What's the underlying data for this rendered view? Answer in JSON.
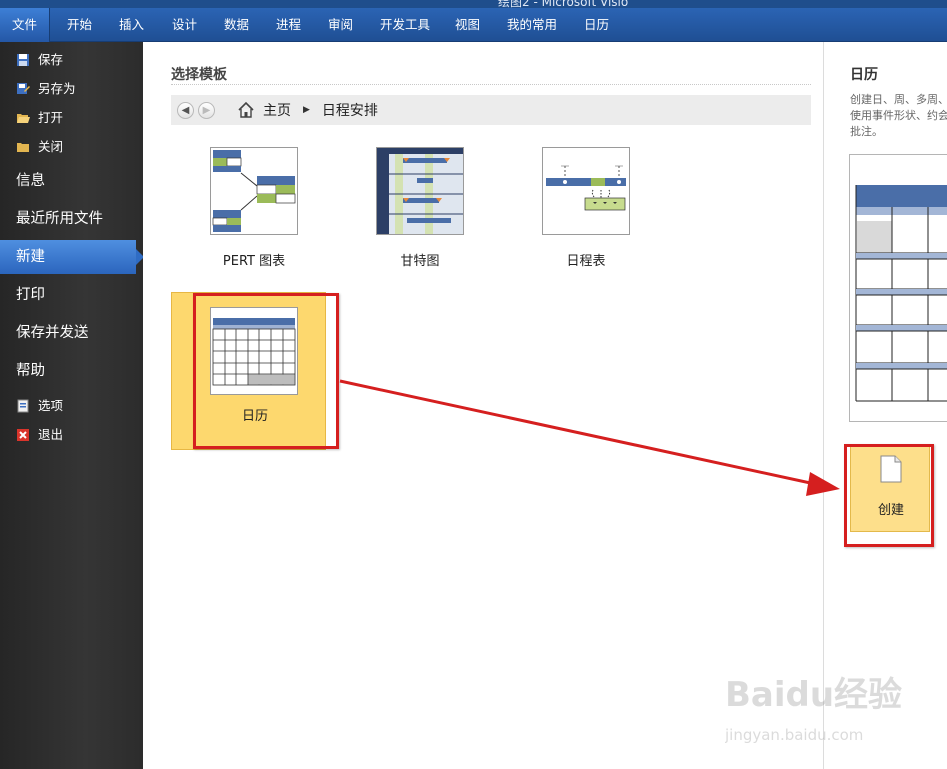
{
  "window": {
    "title": "绘图2 - Microsoft Visio"
  },
  "ribbon": {
    "tabs": [
      "文件",
      "开始",
      "插入",
      "设计",
      "数据",
      "进程",
      "审阅",
      "开发工具",
      "视图",
      "我的常用",
      "日历"
    ]
  },
  "nav": {
    "save": "保存",
    "save_as": "另存为",
    "open": "打开",
    "close": "关闭",
    "info": "信息",
    "recent": "最近所用文件",
    "new": "新建",
    "print": "打印",
    "save_send": "保存并发送",
    "help": "帮助",
    "options": "选项",
    "exit": "退出"
  },
  "main": {
    "section_title": "选择模板",
    "breadcrumb": {
      "home": "主页",
      "current": "日程安排"
    },
    "templates": [
      {
        "label": "PERT 图表",
        "icon": "pert-chart-icon"
      },
      {
        "label": "甘特图",
        "icon": "gantt-chart-icon"
      },
      {
        "label": "日程表",
        "icon": "timeline-icon"
      },
      {
        "label": "日历",
        "icon": "calendar-icon",
        "selected": true
      }
    ]
  },
  "right_panel": {
    "title": "日历",
    "description_line1": "创建日、周、多周、",
    "description_line2": "使用事件形状、约会",
    "description_line3": "批注。",
    "create_label": "创建"
  },
  "colors": {
    "accent": "#2b65bd",
    "selection": "#fdd86e",
    "highlight_red": "#d51f1f"
  },
  "watermark": {
    "brand": "Baidu经验",
    "url": "jingyan.baidu.com"
  }
}
